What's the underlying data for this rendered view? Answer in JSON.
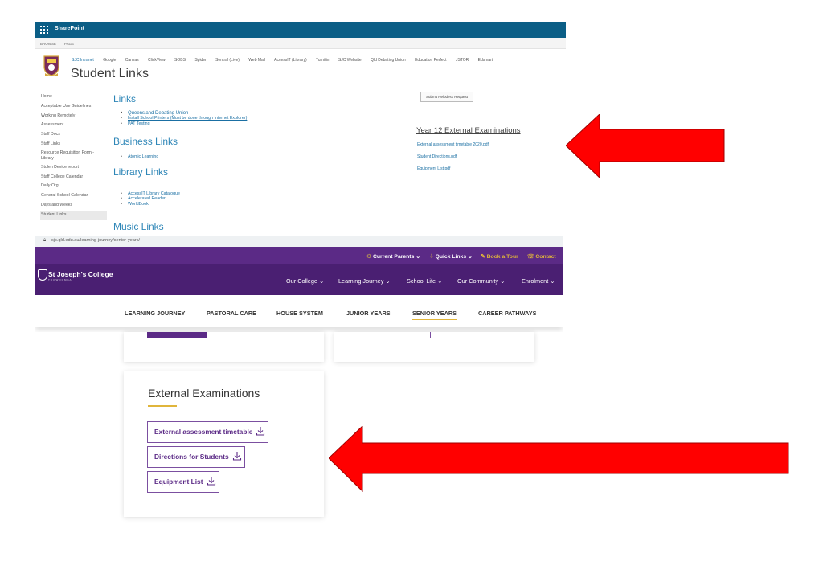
{
  "sharepoint": {
    "brand": "SharePoint",
    "ribbon": [
      "BROWSE",
      "PAGE"
    ],
    "top_links": [
      "SJC Intranet",
      "Google",
      "Canvas",
      "ClickView",
      "SOBS",
      "Spider",
      "Sentral (Live)",
      "Web Mail",
      "AccessIT (Library)",
      "Turnitin",
      "SJC Website",
      "Qld Debating Union",
      "Education Perfect",
      "JSTOR",
      "Edsmart"
    ],
    "title": "Student Links",
    "quick_launch": [
      "Home",
      "Acceptable Use Guidelines",
      "Working Remotely",
      "Assessment",
      "Staff Docs",
      "Staff Links",
      "Resource Requisition Form - Library",
      "Stolen Device report",
      "Staff College Calendar",
      "Daily Org",
      "General School Calendar",
      "Days and Weeks",
      "Student Links"
    ],
    "links_heading": "Links",
    "links": [
      "Queensland Debating Union",
      "Install School Printers (Must be done through Internet Explorer)",
      "PAT Testing"
    ],
    "business_heading": "Business Links",
    "business_links": [
      "Atomic Learning"
    ],
    "library_heading": "Library Links",
    "library_links": [
      "AccessIT Library Catalogue",
      "Accelerated Reader",
      "WorldBook"
    ],
    "submit_button": "Submit Helpdesk Request",
    "exam_heading": "Year 12 External Examinations",
    "exam_files": [
      "External assessment timetable 2020.pdf",
      "Student Directions.pdf",
      "Equipment List.pdf"
    ],
    "music_heading": "Music Links"
  },
  "browser": {
    "url": "sjc.qld.edu.au/learning-journey/senior-years/",
    "top_links": [
      "Current Parents",
      "Quick Links",
      "Book a Tour",
      "Contact"
    ],
    "school_name": "St Joseph's College",
    "school_sub": "TOOWOOMBA",
    "main_menu": [
      "Our College",
      "Learning Journey",
      "School Life",
      "Our Community",
      "Enrolment"
    ],
    "sub_menu": [
      "LEARNING JOURNEY",
      "PASTORAL CARE",
      "HOUSE SYSTEM",
      "JUNIOR YEARS",
      "SENIOR YEARS",
      "CAREER PATHWAYS"
    ]
  },
  "external_exams": {
    "title": "External Examinations",
    "buttons": [
      "External assessment timetable",
      "Directions for Students",
      "Equipment List"
    ]
  },
  "colors": {
    "sharepoint_bar": "#0b5e86",
    "sjc_purple": "#5b2a86",
    "accent_gold": "#e0b53b",
    "arrow_red": "#ff0000"
  }
}
